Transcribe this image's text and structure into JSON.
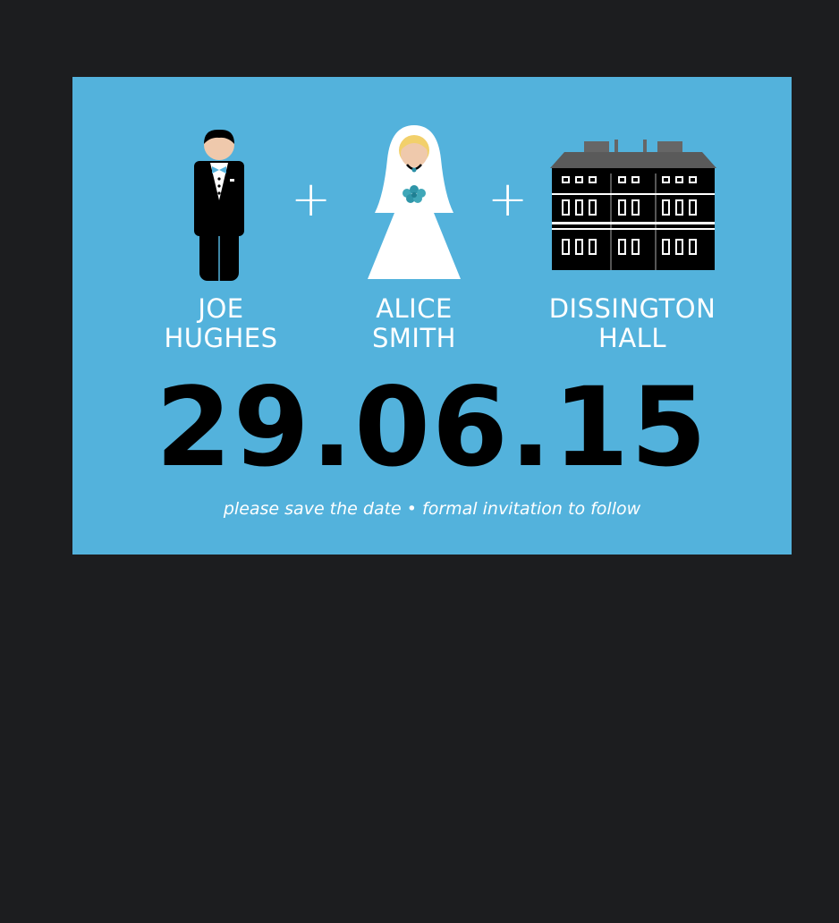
{
  "card": {
    "background_color": "#53b2dc",
    "groom": {
      "first": "JOE",
      "last": "HUGHES",
      "icon": "groom-icon"
    },
    "bride": {
      "first": "ALICE",
      "last": "SMITH",
      "icon": "bride-icon"
    },
    "venue": {
      "first": "DISSINGTON",
      "last": "HALL",
      "icon": "hall-building-icon"
    },
    "plus_symbol": "+",
    "date": "29.06.15",
    "tagline": "please save the date • formal invitation to follow"
  }
}
